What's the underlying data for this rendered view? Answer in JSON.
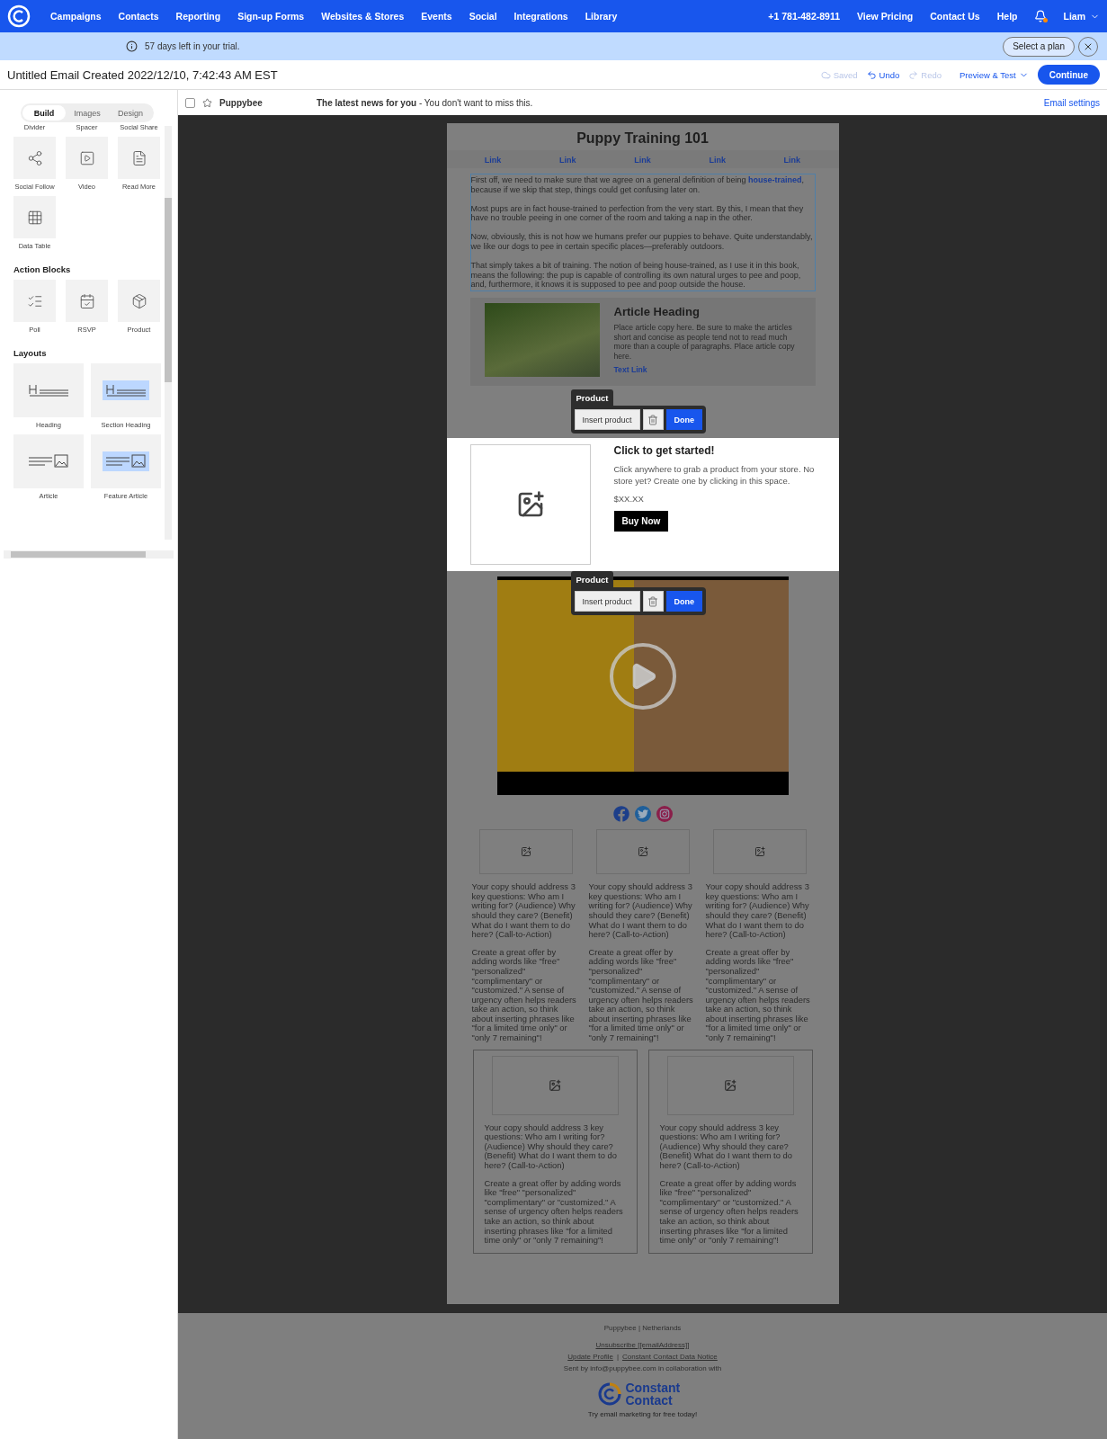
{
  "nav": {
    "items": [
      "Campaigns",
      "Contacts",
      "Reporting",
      "Sign-up Forms",
      "Websites & Stores",
      "Events",
      "Social",
      "Integrations",
      "Library"
    ],
    "right": [
      "+1 781-482-8911",
      "View Pricing",
      "Contact Us",
      "Help"
    ],
    "has_notification": true,
    "user": "Liam"
  },
  "trial_banner": {
    "message": "57 days left in your trial.",
    "button": "Select a plan"
  },
  "header": {
    "title": "Untitled Email Created 2022/12/10, 7:42:43 AM EST",
    "saved": "Saved",
    "undo": "Undo",
    "redo": "Redo",
    "preview": "Preview & Test",
    "continue": "Continue"
  },
  "sidebar": {
    "tabs": [
      {
        "label": "Build",
        "selected": true
      },
      {
        "label": "Images",
        "selected": false
      },
      {
        "label": "Design",
        "selected": false
      }
    ],
    "cut_labels": [
      "Divider",
      "Spacer",
      "Social Share"
    ],
    "groups": [
      {
        "kind": "blocks",
        "tiles": [
          {
            "kind": "social_follow",
            "label": "Social Follow"
          },
          {
            "kind": "video",
            "label": "Video"
          },
          {
            "kind": "read_more",
            "label": "Read More"
          },
          {
            "kind": "data_table",
            "label": "Data Table"
          }
        ]
      },
      {
        "kind": "blocks",
        "title": "Action Blocks",
        "tiles": [
          {
            "kind": "poll",
            "label": "Poll"
          },
          {
            "kind": "rsvp",
            "label": "RSVP"
          },
          {
            "kind": "product",
            "label": "Product"
          }
        ]
      },
      {
        "kind": "layouts",
        "title": "Layouts",
        "tiles": [
          {
            "kind": "heading",
            "label": "Heading"
          },
          {
            "kind": "section_heading",
            "label": "Section Heading"
          },
          {
            "kind": "article",
            "label": "Article"
          },
          {
            "kind": "feature_article",
            "label": "Feature Article"
          }
        ]
      }
    ]
  },
  "subject_row": {
    "checked": false,
    "starred": false,
    "from": "Puppybee",
    "subject": "The latest news for you",
    "preheader": "- You don't want to miss this.",
    "settings": "Email settings"
  },
  "email": {
    "title": "Puppy Training 101",
    "links": [
      "Link",
      "Link",
      "Link",
      "Link",
      "Link"
    ],
    "intro": [
      "First off, we need to make sure that we agree on a general definition of being **house-trained**, because if we skip that step, things could get confusing later on.",
      "Most pups are in fact house-trained to perfection from the very start. By this, I mean that they have no trouble peeing in one corner of the room and taking a nap in the other.",
      "Now, obviously, this is not how we humans prefer our puppies to behave. Quite understandably, we like our dogs to pee in certain specific places—preferably outdoors.",
      "That simply takes a bit of training. The notion of being house-trained, as I use it in this book, means the following: the pup is capable of controlling its own natural urges to pee and poop, and, furthermore, it knows it is supposed to pee and poop outside the house."
    ],
    "article": {
      "heading": "Article Heading",
      "body": "Place article copy here. Be sure to make the articles short and concise as people tend not to read much more than a couple of paragraphs. Place article copy here.",
      "link": "Text Link"
    },
    "product": {
      "toolbar": {
        "label": "Product",
        "insert": "Insert product",
        "done": "Done"
      },
      "heading": "Click to get started!",
      "body": "Click anywhere to grab a product from your store. No store yet? Create one by clicking in this space.",
      "price": "$XX.XX",
      "button": "Buy Now"
    },
    "video": {
      "toolbar": {
        "label": "Product",
        "insert": "Insert product",
        "done": "Done"
      }
    },
    "social": [
      {
        "kind": "facebook"
      },
      {
        "kind": "twitter"
      },
      {
        "kind": "instagram"
      }
    ],
    "columns3": [
      {
        "paragraphs": [
          "Your copy should address 3 key questions: Who am I writing for? (Audience) Why should they care? (Benefit) What do I want them to do here? (Call-to-Action)",
          "Create a great offer by adding words like \"free\" \"personalized\" \"complimentary\" or \"customized.\" A sense of urgency often helps readers take an action, so think about inserting phrases like \"for a limited time only\" or \"only 7 remaining\"!"
        ]
      },
      {
        "paragraphs": [
          "Your copy should address 3 key questions: Who am I writing for? (Audience) Why should they care? (Benefit) What do I want them to do here? (Call-to-Action)",
          "Create a great offer by adding words like \"free\" \"personalized\" \"complimentary\" or \"customized.\" A sense of urgency often helps readers take an action, so think about inserting phrases like \"for a limited time only\" or \"only 7 remaining\"!"
        ]
      },
      {
        "paragraphs": [
          "Your copy should address 3 key questions: Who am I writing for? (Audience) Why should they care? (Benefit) What do I want them to do here? (Call-to-Action)",
          "Create a great offer by adding words like \"free\" \"personalized\" \"complimentary\" or \"customized.\" A sense of urgency often helps readers take an action, so think about inserting phrases like \"for a limited time only\" or \"only 7 remaining\"!"
        ]
      }
    ],
    "columns2": [
      {
        "paragraphs": [
          "Your copy should address 3 key questions: Who am I writing for? (Audience) Why should they care? (Benefit) What do I want them to do here? (Call-to-Action)",
          "Create a great offer by adding words like \"free\" \"personalized\" \"complimentary\" or \"customized.\" A sense of urgency often helps readers take an action, so think about inserting phrases like \"for a limited time only\" or \"only 7 remaining\"!"
        ]
      },
      {
        "paragraphs": [
          "Your copy should address 3 key questions: Who am I writing for? (Audience) Why should they care? (Benefit) What do I want them to do here? (Call-to-Action)",
          "Create a great offer by adding words like \"free\" \"personalized\" \"complimentary\" or \"customized.\" A sense of urgency often helps readers take an action, so think about inserting phrases like \"for a limited time only\" or \"only 7 remaining\"!"
        ]
      }
    ]
  },
  "footer": {
    "company": "Puppybee | Netherlands",
    "unsubscribe": "Unsubscribe [[emailAddress]]",
    "update_profile": "Update Profile",
    "separator": "|",
    "data_notice": "Constant Contact Data Notice",
    "sent_by": "Sent by info@puppybee.com in collaboration with",
    "logo_text": "Constant Contact",
    "tagline": "Try email marketing for free today!"
  }
}
